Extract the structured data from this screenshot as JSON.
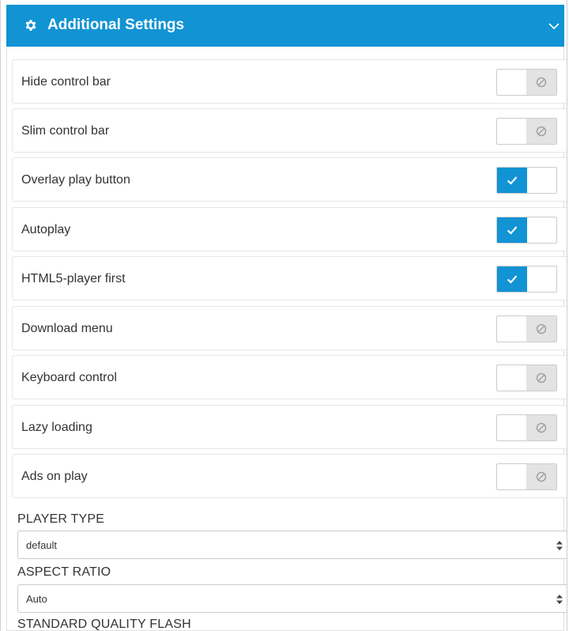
{
  "header": {
    "title": "Additional Settings",
    "icon": "gear-icon",
    "collapse_icon": "chevron-down-icon",
    "bg_color": "#1193d4"
  },
  "settings": [
    {
      "label": "Hide control bar",
      "enabled": false
    },
    {
      "label": "Slim control bar",
      "enabled": false
    },
    {
      "label": "Overlay play button",
      "enabled": true
    },
    {
      "label": "Autoplay",
      "enabled": true
    },
    {
      "label": "HTML5-player first",
      "enabled": true
    },
    {
      "label": "Download menu",
      "enabled": false
    },
    {
      "label": "Keyboard control",
      "enabled": false
    },
    {
      "label": "Lazy loading",
      "enabled": false
    },
    {
      "label": "Ads on play",
      "enabled": false
    }
  ],
  "player_type": {
    "label": "PLAYER TYPE",
    "value": "default"
  },
  "aspect_ratio": {
    "label": "ASPECT RATIO",
    "value": "Auto"
  },
  "standard_quality_flash": {
    "label": "STANDARD QUALITY FLASH"
  },
  "colors": {
    "accent": "#1193d4",
    "off_state": "#e3e3e3"
  }
}
